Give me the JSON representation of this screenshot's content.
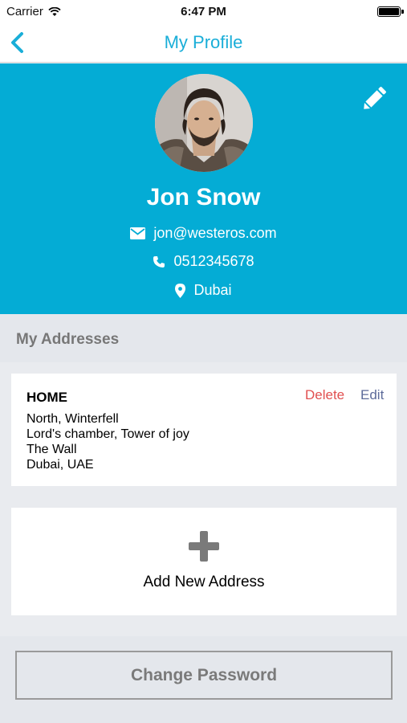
{
  "status_bar": {
    "carrier": "Carrier",
    "time": "6:47 PM"
  },
  "nav": {
    "title": "My Profile"
  },
  "profile": {
    "name": "Jon Snow",
    "email": "jon@westeros.com",
    "phone": "0512345678",
    "location": "Dubai"
  },
  "addresses": {
    "section_title": "My Addresses",
    "items": [
      {
        "type": "HOME",
        "delete_label": "Delete",
        "edit_label": "Edit",
        "lines": [
          "North, Winterfell",
          "Lord's chamber, Tower of joy",
          "The Wall",
          "Dubai, UAE"
        ]
      }
    ],
    "add_label": "Add New Address"
  },
  "change_password_label": "Change Password",
  "colors": {
    "accent": "#1aaed8",
    "header_bg": "#04acd5",
    "delete": "#e15050",
    "edit": "#5d6b9a"
  }
}
